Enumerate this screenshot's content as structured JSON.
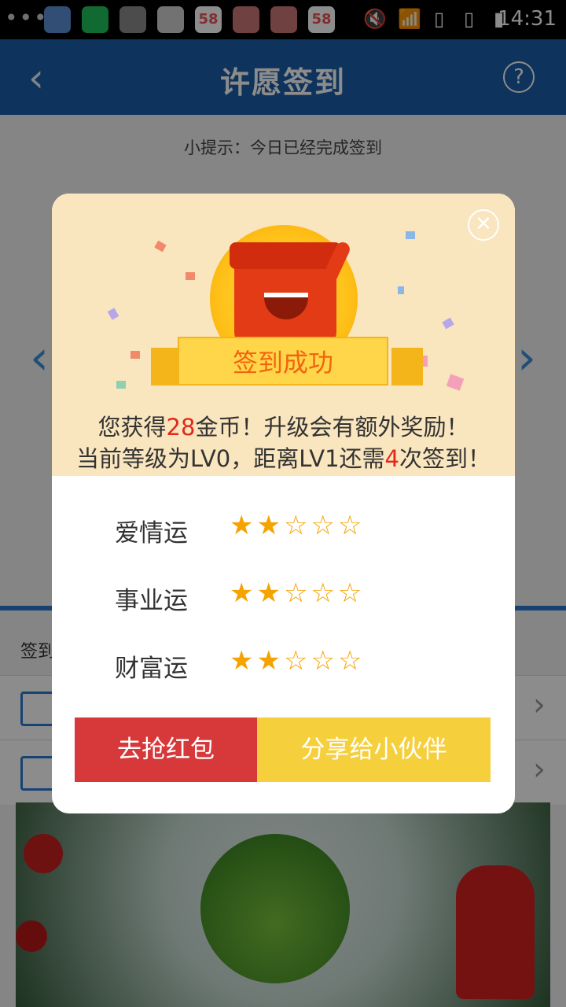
{
  "status_bar": {
    "dots": "•••",
    "time": "14:31",
    "app_badges": [
      "58",
      "58"
    ]
  },
  "header": {
    "title": "许愿签到",
    "back_icon": "chevron-left-icon",
    "help_icon": "?"
  },
  "tip": "小提示：今日已经完成签到",
  "background": {
    "row_label": "签到",
    "rows": [
      {
        "icon": "calendar-icon"
      },
      {
        "icon": "store-icon"
      }
    ]
  },
  "dialog": {
    "ribbon_text": "签到成功",
    "line1": {
      "pre": "您获得",
      "coins": "28",
      "post": "金币！升级会有额外奖励！"
    },
    "line2": {
      "pre": "当前等级为LV0，距离LV1还需",
      "count": "4",
      "post": "次签到！"
    },
    "fortunes": [
      {
        "label": "爱情运",
        "rating": 2,
        "stars": "★★☆☆☆"
      },
      {
        "label": "事业运",
        "rating": 2,
        "stars": "★★☆☆☆"
      },
      {
        "label": "财富运",
        "rating": 2,
        "stars": "★★☆☆☆"
      }
    ],
    "buttons": {
      "grab": "去抢红包",
      "share": "分享给小伙伴"
    }
  },
  "colors": {
    "header": "#1b5ea8",
    "dialog_top": "#f9e5be",
    "star": "#f5a300",
    "btn_red": "#d7383a",
    "btn_yellow": "#f5cf3c",
    "highlight": "#e4271a"
  }
}
